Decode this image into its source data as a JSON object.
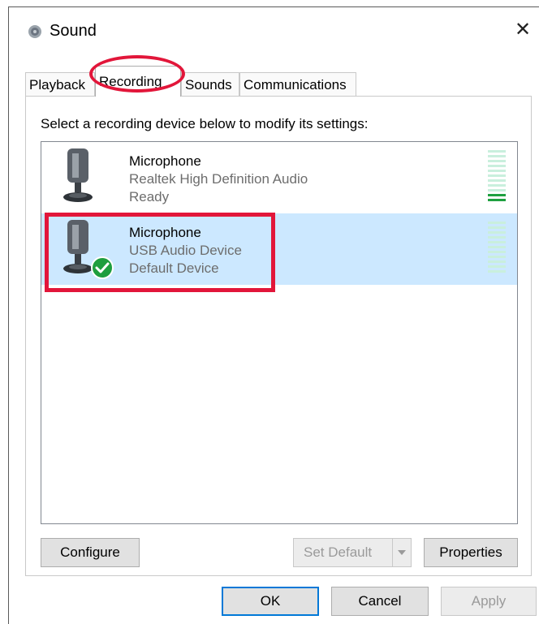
{
  "window": {
    "title": "Sound",
    "close_glyph": "✕"
  },
  "tabs": [
    {
      "label": "Playback",
      "active": false
    },
    {
      "label": "Recording",
      "active": true
    },
    {
      "label": "Sounds",
      "active": false
    },
    {
      "label": "Communications",
      "active": false
    }
  ],
  "panel": {
    "instructions": "Select a recording device below to modify its settings:",
    "devices": [
      {
        "name": "Microphone",
        "description": "Realtek High Definition Audio",
        "status": "Ready",
        "selected": false,
        "default": false,
        "icon": "microphone-icon",
        "meter_level": 0.2
      },
      {
        "name": "Microphone",
        "description": "USB Audio Device",
        "status": "Default Device",
        "selected": true,
        "default": true,
        "icon": "microphone-icon",
        "badge_icon": "checkmark-badge-icon",
        "meter_level": 0
      }
    ]
  },
  "buttons": {
    "configure": "Configure",
    "set_default": "Set Default",
    "properties": "Properties",
    "ok": "OK",
    "cancel": "Cancel",
    "apply": "Apply"
  },
  "colors": {
    "selection": "#cce8ff",
    "annotation": "#e2163a",
    "meter_active": "#1fa040",
    "default_badge": "#1e9e3e"
  }
}
